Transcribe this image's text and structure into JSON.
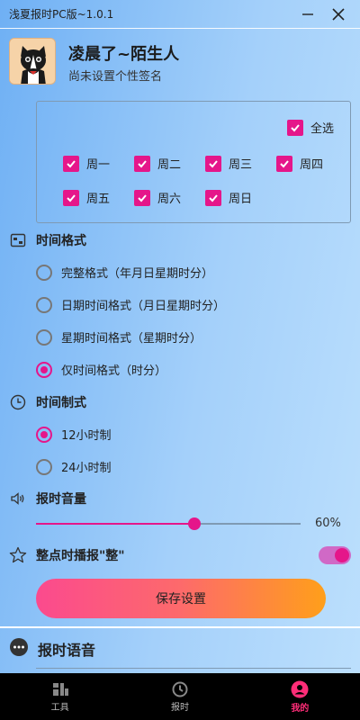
{
  "window": {
    "title": "浅夏报时PC版~1.0.1"
  },
  "profile": {
    "nickname": "凌晨了~陌生人",
    "signature": "尚未设置个性签名"
  },
  "days": {
    "select_all": "全选",
    "items": [
      {
        "label": "周一",
        "checked": true
      },
      {
        "label": "周二",
        "checked": true
      },
      {
        "label": "周三",
        "checked": true
      },
      {
        "label": "周四",
        "checked": true
      },
      {
        "label": "周五",
        "checked": true
      },
      {
        "label": "周六",
        "checked": true
      },
      {
        "label": "周日",
        "checked": true
      }
    ]
  },
  "time_format": {
    "heading": "时间格式",
    "options": [
      {
        "label": "完整格式（年月日星期时分）",
        "selected": false
      },
      {
        "label": "日期时间格式（月日星期时分）",
        "selected": false
      },
      {
        "label": "星期时间格式（星期时分）",
        "selected": false
      },
      {
        "label": "仅时间格式（时分）",
        "selected": true
      }
    ]
  },
  "time_system": {
    "heading": "时间制式",
    "options": [
      {
        "label": "12小时制",
        "selected": true
      },
      {
        "label": "24小时制",
        "selected": false
      }
    ]
  },
  "volume": {
    "heading": "报时音量",
    "value_label": "60%",
    "value": 0.6
  },
  "hourly": {
    "label": "整点时播报\"整\"",
    "enabled": true
  },
  "save_button": "保存设置",
  "voice_section": {
    "heading": "报时语音"
  },
  "bottom_nav": [
    {
      "label": "工具",
      "icon": "tools-icon",
      "active": false
    },
    {
      "label": "报时",
      "icon": "clock-icon",
      "active": false
    },
    {
      "label": "我的",
      "icon": "user-icon",
      "active": true
    }
  ],
  "colors": {
    "accent": "#e5168a",
    "nav_active": "#ff2d78"
  }
}
